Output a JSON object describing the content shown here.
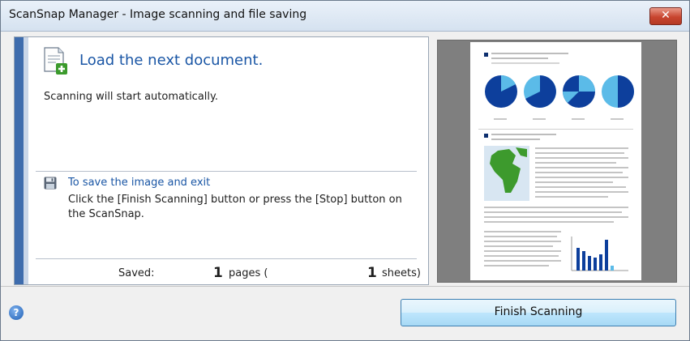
{
  "window": {
    "title": "ScanSnap Manager - Image scanning and file saving",
    "close_glyph": "✕"
  },
  "main": {
    "load_title": "Load the next document.",
    "auto_text": "Scanning will start automatically.",
    "save_title": "To save the image and exit",
    "save_body": "Click the [Finish Scanning] button or press the [Stop] button on the ScanSnap.",
    "saved_label": "Saved:",
    "pages_value": "1",
    "pages_label": "pages (",
    "sheets_value": "1",
    "sheets_label": "sheets)"
  },
  "footer": {
    "help_glyph": "?",
    "finish_label": "Finish Scanning"
  },
  "colors": {
    "accent": "#3e6cad",
    "link": "#1a56a5",
    "pie_dark": "#0d3f9c",
    "pie_light": "#5bbbe8",
    "map_green": "#3d9a2d"
  }
}
